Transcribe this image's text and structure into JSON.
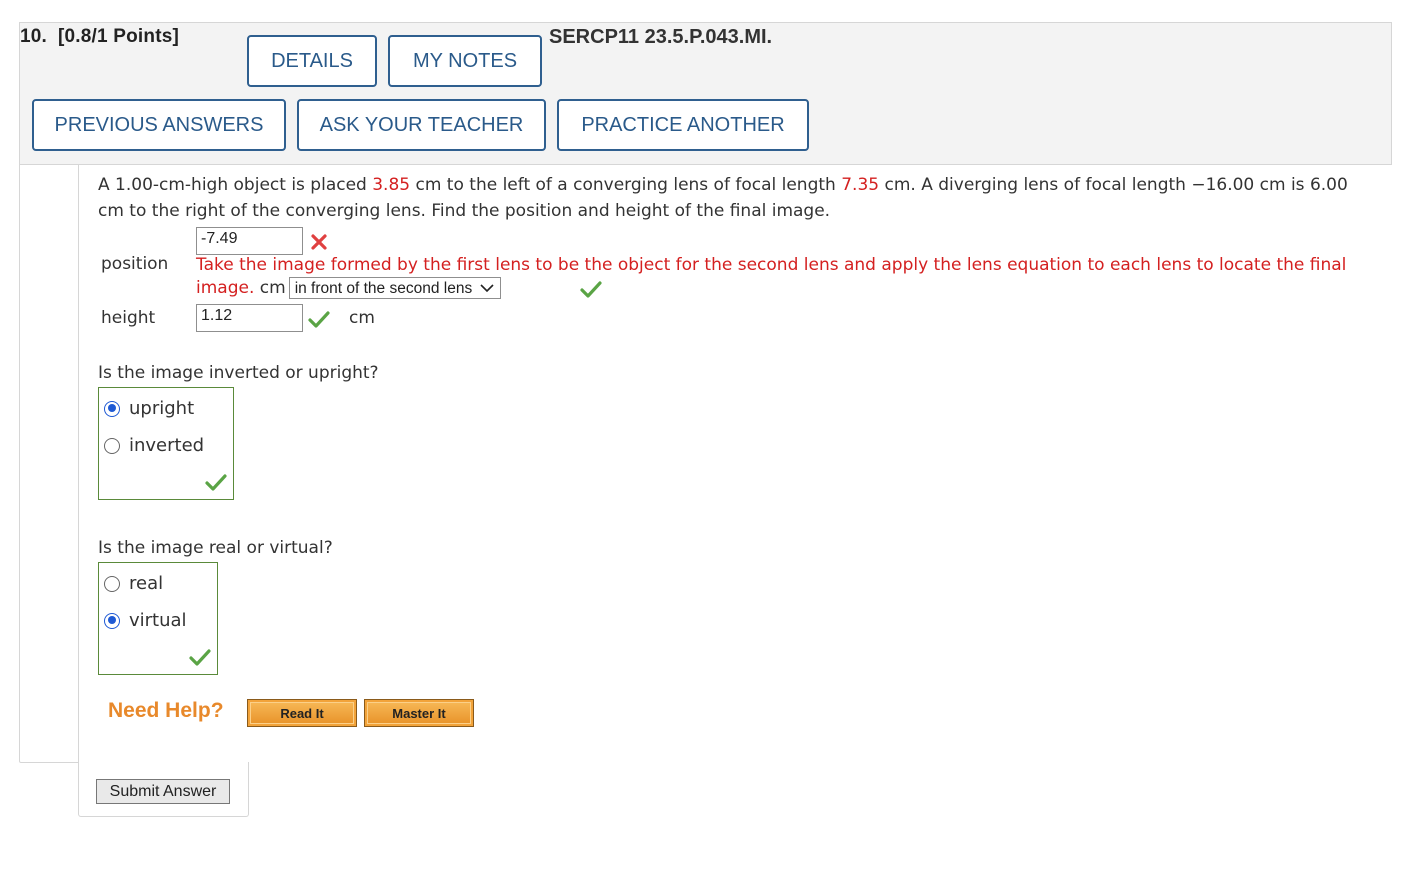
{
  "question": {
    "number": "10.",
    "points": "[0.8/1 Points]",
    "reference": "SERCP11 23.5.P.043.MI.",
    "buttons": {
      "details": "DETAILS",
      "my_notes": "MY NOTES",
      "previous_answers": "PREVIOUS ANSWERS",
      "ask_teacher": "ASK YOUR TEACHER",
      "practice_another": "PRACTICE ANOTHER"
    },
    "text": {
      "p1": "A 1.00-cm-high object is placed ",
      "v1": "3.85",
      "p2": " cm to the left of a converging lens of focal length ",
      "v2": "7.35",
      "p3": " cm. A diverging lens of focal length −16.00 cm is 6.00 cm to the right of the converging lens. Find the position and height of the final image."
    }
  },
  "answers": {
    "position": {
      "label": "position",
      "value": "-7.49",
      "status": "incorrect",
      "hint": "Take the image formed by the first lens to be the object for the second lens and apply the lens equation to each lens to locate the final image.",
      "unit": "cm",
      "dropdown_selected": "in front of the second lens",
      "dropdown_status": "correct"
    },
    "height": {
      "label": "height",
      "value": "1.12",
      "status": "correct",
      "unit": "cm"
    }
  },
  "q_orientation": {
    "prompt": "Is the image inverted or upright?",
    "options": [
      "upright",
      "inverted"
    ],
    "selected": "upright",
    "status": "correct"
  },
  "q_type": {
    "prompt": "Is the image real or virtual?",
    "options": [
      "real",
      "virtual"
    ],
    "selected": "virtual",
    "status": "correct"
  },
  "help": {
    "label": "Need Help?",
    "read_it": "Read It",
    "master_it": "Master It"
  },
  "submit_label": "Submit Answer",
  "colors": {
    "accent_blue": "#2a5a8a",
    "error_red": "#d42020",
    "success_green": "#5aa445",
    "help_orange": "#e8892b"
  }
}
